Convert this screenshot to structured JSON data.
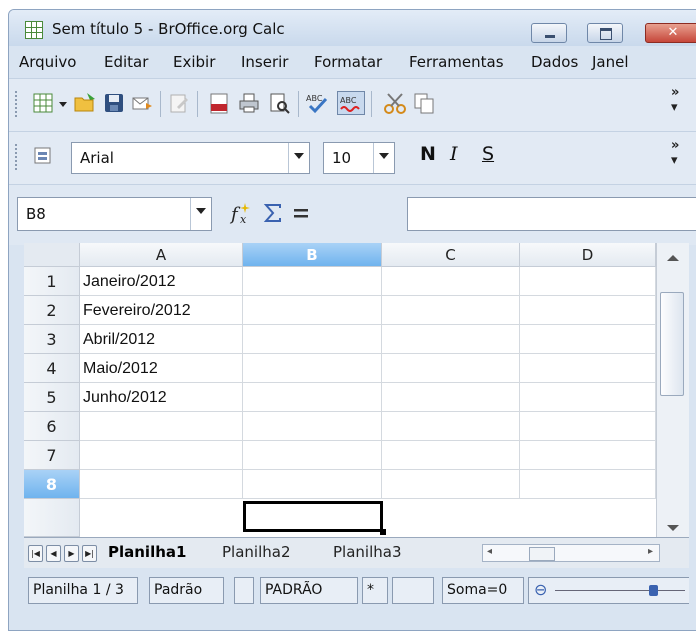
{
  "window": {
    "title": "Sem título 5 - BrOffice.org Calc",
    "close_glyph": "✕"
  },
  "menu": [
    "Arquivo",
    "Editar",
    "Exibir",
    "Inserir",
    "Formatar",
    "Ferramentas",
    "Dados",
    "Janel"
  ],
  "formatting": {
    "font_name": "Arial",
    "font_size": "10",
    "bold_label": "N",
    "italic_label": "I",
    "underline_label": "S"
  },
  "formula_bar": {
    "name_box": "B8",
    "content": ""
  },
  "sheet": {
    "columns": [
      "A",
      "B",
      "C",
      "D"
    ],
    "selected_column": "B",
    "rows": [
      "1",
      "2",
      "3",
      "4",
      "5",
      "6",
      "7",
      "8"
    ],
    "selected_row": "8",
    "column_a_values": [
      "Janeiro/2012",
      "Fevereiro/2012",
      "Abril/2012",
      "Maio/2012",
      "Junho/2012",
      "",
      "",
      ""
    ],
    "active_cell": "B8"
  },
  "tabs": {
    "nav": [
      "|◀",
      "◀",
      "▶",
      "▶|"
    ],
    "sheets": [
      "Planilha1",
      "Planilha2",
      "Planilha3"
    ],
    "active": "Planilha1"
  },
  "status": {
    "sheet_info": "Planilha 1 / 3",
    "page_style": "Padrão",
    "mode": "PADRÃO",
    "modified_marker": "*",
    "sum": "Soma=0"
  },
  "colors": {
    "selection_header": "#6fb3ee",
    "window_bg": "#d9e4f1"
  }
}
